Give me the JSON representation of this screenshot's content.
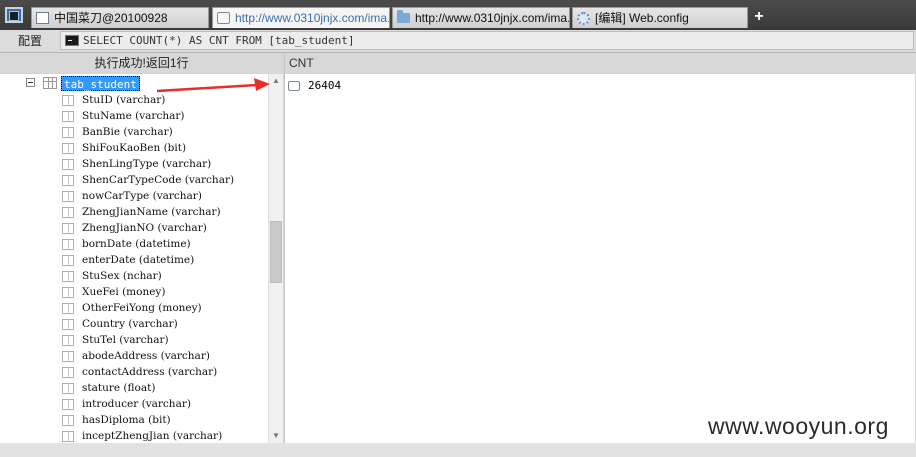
{
  "tabs": [
    {
      "label": "中国菜刀@20100928",
      "icon": "window-icon",
      "active": false
    },
    {
      "label": "http://www.0310jnjx.com/ima...",
      "icon": "document-icon",
      "active": true
    },
    {
      "label": "http://www.0310jnjx.com/ima...",
      "icon": "folder-icon",
      "active": false
    },
    {
      "label": "[编辑] Web.config",
      "icon": "gear-icon",
      "active": false
    }
  ],
  "new_tab_label": "+",
  "toolbar": {
    "config_label": "配置",
    "query": "SELECT COUNT(*) AS CNT FROM [tab_student]"
  },
  "status": {
    "message": "执行成功!返回1行"
  },
  "tree": {
    "root": "tab_student",
    "fields": [
      "StuID (varchar)",
      "StuName (varchar)",
      "BanBie (varchar)",
      "ShiFouKaoBen (bit)",
      "ShenLingType (varchar)",
      "ShenCarTypeCode (varchar)",
      "nowCarType (varchar)",
      "ZhengJianName (varchar)",
      "ZhengJianNO (varchar)",
      "bornDate (datetime)",
      "enterDate (datetime)",
      "StuSex (nchar)",
      "XueFei (money)",
      "OtherFeiYong (money)",
      "Country (varchar)",
      "StuTel (varchar)",
      "abodeAddress (varchar)",
      "contactAddress (varchar)",
      "stature (float)",
      "introducer (varchar)",
      "hasDiploma (bit)",
      "inceptZhengJian (varchar)"
    ]
  },
  "results": {
    "columns": [
      "CNT"
    ],
    "rows": [
      [
        "26404"
      ]
    ]
  },
  "watermark": "www.wooyun.org",
  "colors": {
    "tabbar": "#3e3e3e",
    "selection": "#3399ff",
    "annotation_arrow": "#e5302a",
    "active_tab_text": "#3a6fb0"
  }
}
